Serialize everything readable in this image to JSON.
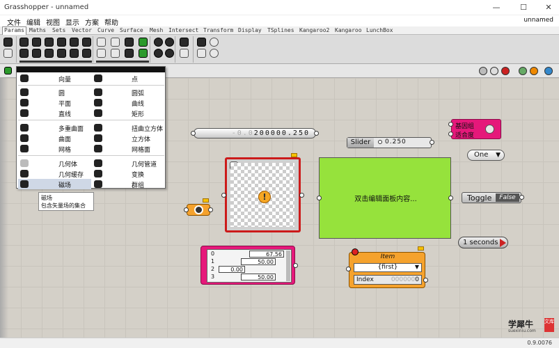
{
  "window": {
    "title": "Grasshopper - unnamed",
    "minimize": "—",
    "maximize": "☐",
    "close": "✕"
  },
  "menu": {
    "items": [
      "文件",
      "编辑",
      "视图",
      "显示",
      "方案",
      "帮助"
    ],
    "doc_name": "unnamed"
  },
  "tabs": [
    "Params",
    "Maths",
    "Sets",
    "Vector",
    "Curve",
    "Surface",
    "Mesh",
    "Intersect",
    "Transform",
    "Display",
    "TSplines",
    "Kangaroo2",
    "Kangaroo",
    "LunchBox"
  ],
  "dropdown": {
    "items": [
      [
        "向量",
        "点"
      ],
      [
        "圆",
        "圆弧"
      ],
      [
        "平面",
        "曲线"
      ],
      [
        "直线",
        "矩形"
      ],
      [
        "多重曲面",
        "扭曲立方体"
      ],
      [
        "曲面",
        "立方体"
      ],
      [
        "网格",
        "网格面"
      ],
      [
        "几何体",
        "几何管道"
      ],
      [
        "几何缓存",
        "变换"
      ],
      [
        "磁场",
        "群组"
      ]
    ],
    "selected": "磁场"
  },
  "tooltip": {
    "title": "磁场",
    "desc": "包含矢量场的集合"
  },
  "canvas": {
    "number_slider": {
      "dim": "-0.0",
      "value": "200000.250"
    },
    "slider": {
      "label": "Slider",
      "value": "0.250"
    },
    "gene_pool": {
      "line1": "基因组",
      "line2": "适合度"
    },
    "value_list": {
      "value": "One",
      "arrow": "▼"
    },
    "panel": {
      "text": "双击编辑面板内容..."
    },
    "toggle": {
      "label": "Toggle",
      "value": "False"
    },
    "timer": {
      "label": "1 seconds"
    },
    "warning": "!",
    "data_stream": {
      "rows": [
        {
          "idx": "0",
          "value": "67.56"
        },
        {
          "idx": "1",
          "value": "50.00"
        },
        {
          "idx": "2",
          "value": "0.00"
        },
        {
          "idx": "3",
          "value": "50.00"
        }
      ]
    },
    "item": {
      "title": "Item",
      "selected": "{first}",
      "arrow": "▼",
      "index_label": "Index",
      "index_dim": "000000",
      "index_value": "0"
    }
  },
  "watermark": {
    "brand": "学犀牛",
    "site": "suexiniu.com",
    "badge": "文库"
  },
  "status": {
    "version": "0.9.0076"
  },
  "colors": {
    "canvas": "#d4d0c8",
    "panel": "#96e23c",
    "pink": "#e5187a",
    "orange": "#f5a22d",
    "bitmap_border": "#cc1a1a"
  }
}
